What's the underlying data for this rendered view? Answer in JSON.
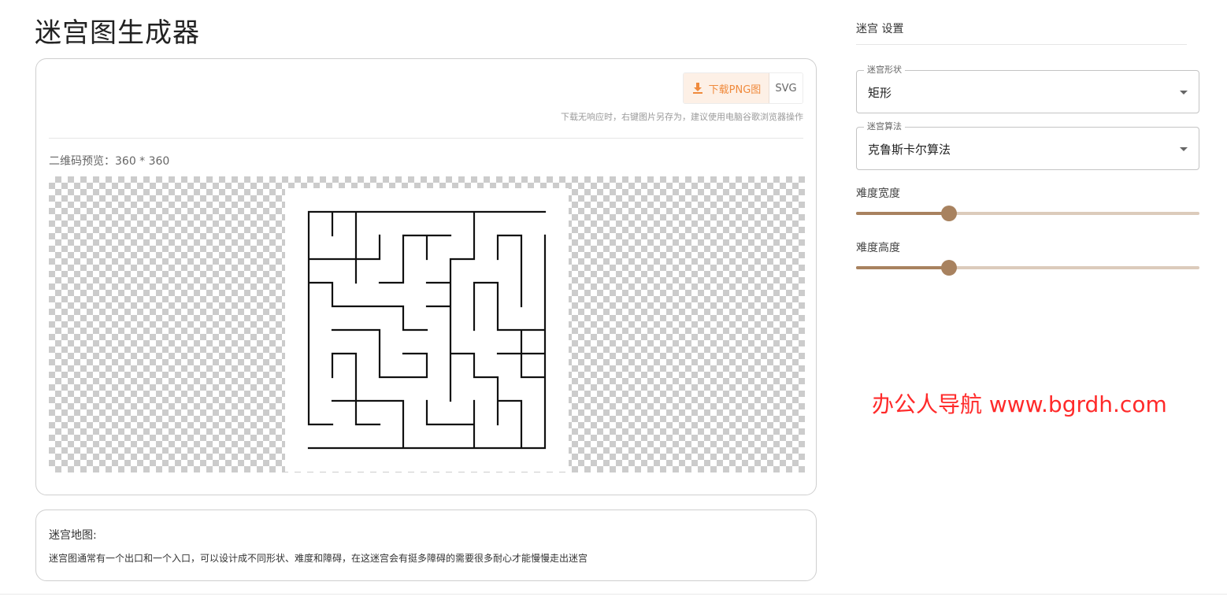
{
  "page": {
    "title": "迷宫图生成器"
  },
  "toolbar": {
    "download_png_label": "下载PNG图",
    "svg_label": "SVG",
    "download_icon": "download-icon",
    "hint": "下载无响应时，右键图片另存为，建议使用电脑谷歌浏览器操作"
  },
  "preview": {
    "label": "二维码预览：360 * 360"
  },
  "description": {
    "title": "迷宫地图:",
    "text": "迷宫图通常有一个出口和一个入口，可以设计成不同形状、难度和障碍，在这迷宫会有挺多障碍的需要很多耐心才能慢慢走出迷宫"
  },
  "settings": {
    "title": "迷宫 设置",
    "shape": {
      "label": "迷宫形状",
      "value": "矩形"
    },
    "algorithm": {
      "label": "迷宫算法",
      "value": "克鲁斯卡尔算法"
    },
    "width_slider": {
      "label": "难度宽度",
      "fraction": 0.27
    },
    "height_slider": {
      "label": "难度高度",
      "fraction": 0.27
    }
  },
  "watermark": "办公人导航 www.bgrdh.com",
  "colors": {
    "accent": "#a8825f",
    "accent_light": "#dccbbb",
    "download_text": "#f08a3c",
    "download_bg": "#fdf0e6",
    "watermark": "#ff2a2a"
  }
}
